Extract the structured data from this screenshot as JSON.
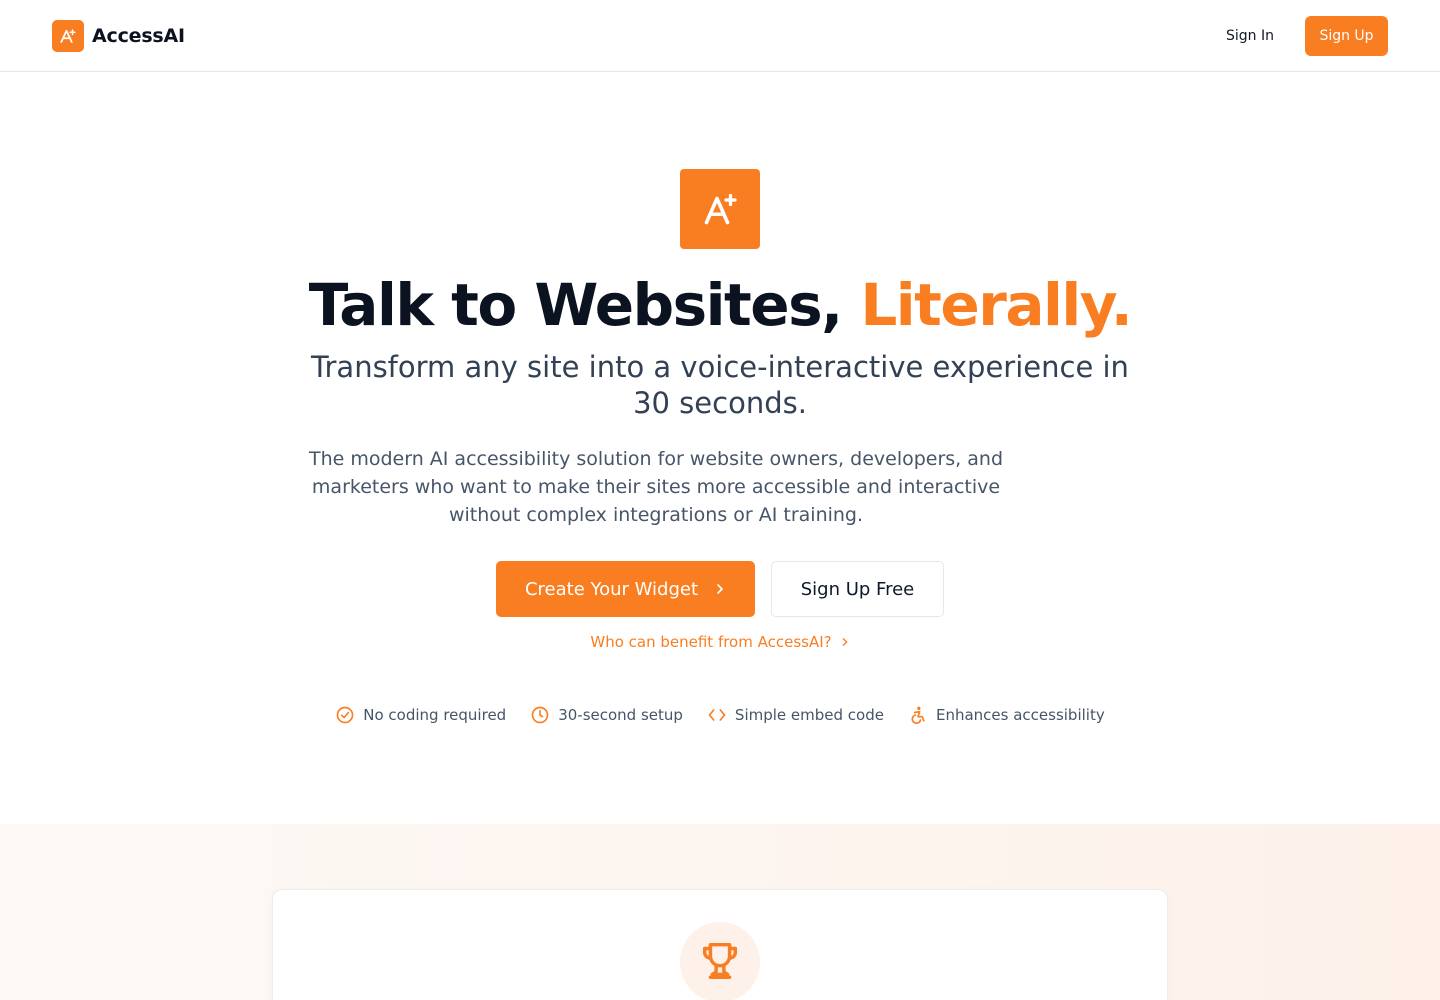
{
  "header": {
    "brand_name": "AccessAI",
    "sign_in_label": "Sign In",
    "sign_up_label": "Sign Up"
  },
  "hero": {
    "headline_main": "Talk to Websites,",
    "headline_accent": "Literally.",
    "subheadline": "Transform any site into a voice-interactive experience in 30 seconds.",
    "description": "The modern AI accessibility solution for website owners, developers, and marketers who want to make their sites more accessible and interactive without complex integrations or AI training.",
    "primary_cta_label": "Create Your Widget",
    "secondary_cta_label": "Sign Up Free",
    "benefit_link_label": "Who can benefit from AccessAI?"
  },
  "features": [
    {
      "icon": "check-circle-icon",
      "label": "No coding required"
    },
    {
      "icon": "clock-icon",
      "label": "30-second setup"
    },
    {
      "icon": "code-icon",
      "label": "Simple embed code"
    },
    {
      "icon": "accessibility-icon",
      "label": "Enhances accessibility"
    }
  ],
  "colors": {
    "accent": "#f97e22",
    "heading": "#0b1220",
    "body_text": "#475569",
    "card_bg_tint": "#fdf1ea"
  }
}
